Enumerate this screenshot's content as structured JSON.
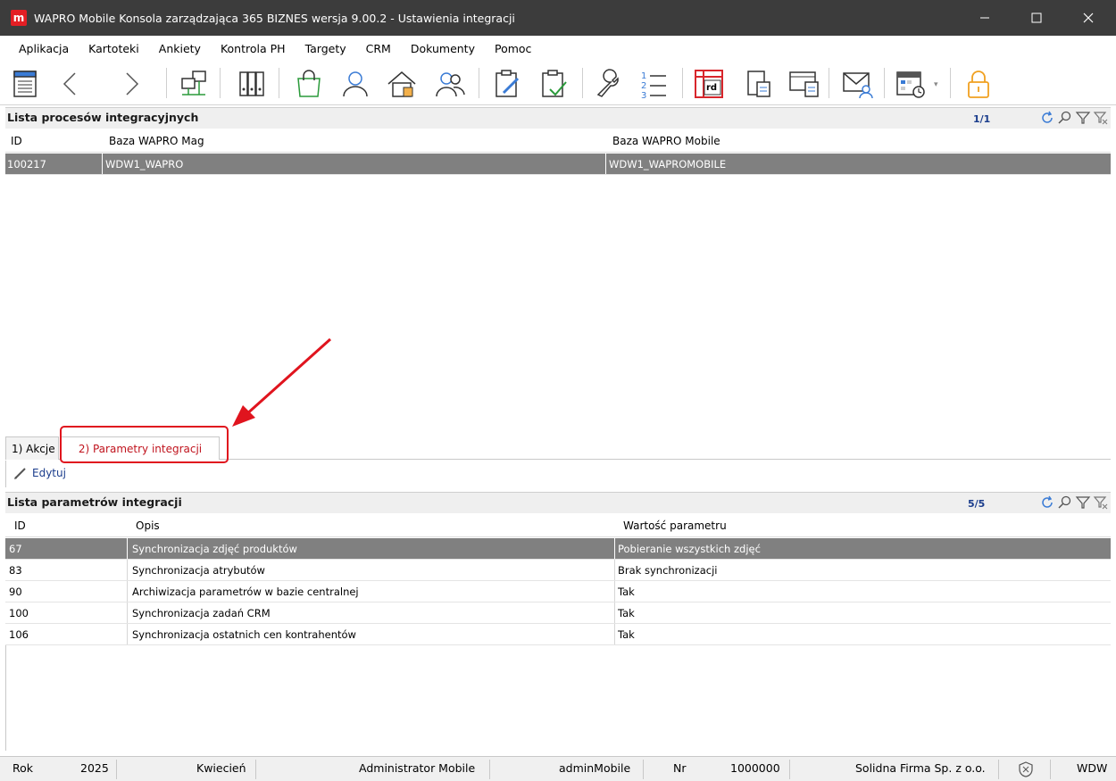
{
  "window": {
    "title": "WAPRO Mobile Konsola zarządzająca 365 BIZNES wersja 9.00.2 - Ustawienia integracji",
    "logo_letter": "m"
  },
  "menu": [
    "Aplikacja",
    "Kartoteki",
    "Ankiety",
    "Kontrola PH",
    "Targety",
    "CRM",
    "Dokumenty",
    "Pomoc"
  ],
  "toolbar": {
    "icons": [
      "form-icon",
      "back-arrow-icon",
      "forward-arrow-icon",
      "network-icon",
      "binders-icon",
      "shopping-bag-icon",
      "user-icon",
      "house-icon",
      "users-icon",
      "clipboard-edit-icon",
      "clipboard-check-icon",
      "wrench-icon",
      "numbered-list-icon",
      "rd-table-icon",
      "document-icon",
      "monitor-icon",
      "mail-user-icon",
      "calendar-icon",
      "lock-icon"
    ],
    "rd_label": "rd"
  },
  "integration_list": {
    "title": "Lista procesów integracyjnych",
    "counter": "1/1",
    "columns": [
      "ID",
      "Baza WAPRO Mag",
      "Baza WAPRO Mobile"
    ],
    "rows": [
      {
        "id": "100217",
        "mag": "WDW1_WAPRO",
        "mobile": "WDW1_WAPROMOBILE"
      }
    ]
  },
  "tabs": [
    {
      "label": "1) Akcje"
    },
    {
      "label": "2) Parametry integracji"
    }
  ],
  "edit_label": "Edytuj",
  "param_list": {
    "title": "Lista parametrów integracji",
    "counter": "5/5",
    "columns": [
      "ID",
      "Opis",
      "Wartość parametru"
    ],
    "rows": [
      {
        "id": "67",
        "opis": "Synchronizacja zdjęć produktów",
        "wartosc": "Pobieranie wszystkich zdjęć"
      },
      {
        "id": "83",
        "opis": "Synchronizacja atrybutów",
        "wartosc": "Brak synchronizacji"
      },
      {
        "id": "90",
        "opis": "Archiwizacja parametrów w bazie centralnej",
        "wartosc": "Tak"
      },
      {
        "id": "100",
        "opis": "Synchronizacja zadań CRM",
        "wartosc": "Tak"
      },
      {
        "id": "106",
        "opis": "Synchronizacja ostatnich cen kontrahentów",
        "wartosc": "Tak"
      }
    ]
  },
  "status": {
    "rok_label": "Rok",
    "rok": "2025",
    "miesiac": "Kwiecień",
    "user": "Administrator Mobile",
    "login": "adminMobile",
    "nr_label": "Nr",
    "nr": "1000000",
    "firma": "Solidna Firma Sp. z o.o.",
    "db": "WDW"
  },
  "colors": {
    "titlebar": "#3c3c3c",
    "selection": "#808080",
    "accent_red": "#e0141e",
    "counter_blue": "#1a3c8c"
  }
}
